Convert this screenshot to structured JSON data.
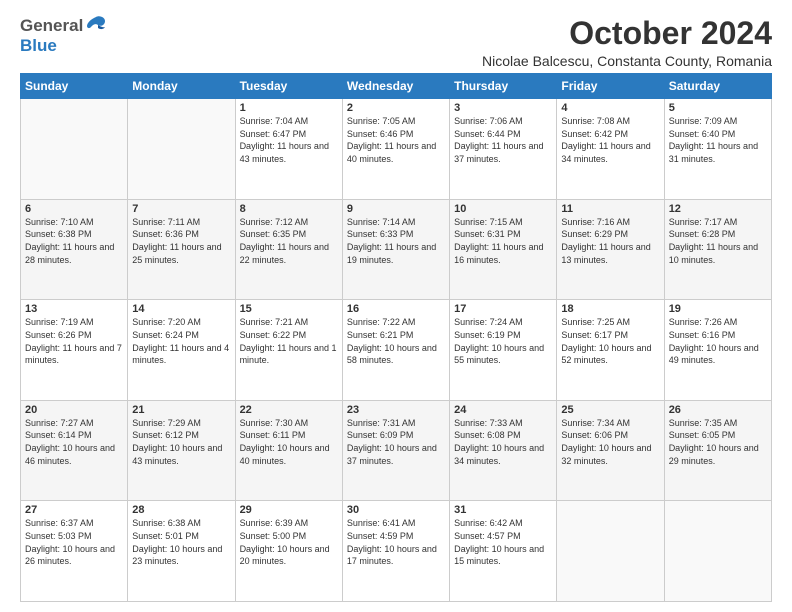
{
  "logo": {
    "general": "General",
    "blue": "Blue"
  },
  "title": "October 2024",
  "location": "Nicolae Balcescu, Constanta County, Romania",
  "weekdays": [
    "Sunday",
    "Monday",
    "Tuesday",
    "Wednesday",
    "Thursday",
    "Friday",
    "Saturday"
  ],
  "weeks": [
    [
      {
        "day": "",
        "info": ""
      },
      {
        "day": "",
        "info": ""
      },
      {
        "day": "1",
        "info": "Sunrise: 7:04 AM\nSunset: 6:47 PM\nDaylight: 11 hours and 43 minutes."
      },
      {
        "day": "2",
        "info": "Sunrise: 7:05 AM\nSunset: 6:46 PM\nDaylight: 11 hours and 40 minutes."
      },
      {
        "day": "3",
        "info": "Sunrise: 7:06 AM\nSunset: 6:44 PM\nDaylight: 11 hours and 37 minutes."
      },
      {
        "day": "4",
        "info": "Sunrise: 7:08 AM\nSunset: 6:42 PM\nDaylight: 11 hours and 34 minutes."
      },
      {
        "day": "5",
        "info": "Sunrise: 7:09 AM\nSunset: 6:40 PM\nDaylight: 11 hours and 31 minutes."
      }
    ],
    [
      {
        "day": "6",
        "info": "Sunrise: 7:10 AM\nSunset: 6:38 PM\nDaylight: 11 hours and 28 minutes."
      },
      {
        "day": "7",
        "info": "Sunrise: 7:11 AM\nSunset: 6:36 PM\nDaylight: 11 hours and 25 minutes."
      },
      {
        "day": "8",
        "info": "Sunrise: 7:12 AM\nSunset: 6:35 PM\nDaylight: 11 hours and 22 minutes."
      },
      {
        "day": "9",
        "info": "Sunrise: 7:14 AM\nSunset: 6:33 PM\nDaylight: 11 hours and 19 minutes."
      },
      {
        "day": "10",
        "info": "Sunrise: 7:15 AM\nSunset: 6:31 PM\nDaylight: 11 hours and 16 minutes."
      },
      {
        "day": "11",
        "info": "Sunrise: 7:16 AM\nSunset: 6:29 PM\nDaylight: 11 hours and 13 minutes."
      },
      {
        "day": "12",
        "info": "Sunrise: 7:17 AM\nSunset: 6:28 PM\nDaylight: 11 hours and 10 minutes."
      }
    ],
    [
      {
        "day": "13",
        "info": "Sunrise: 7:19 AM\nSunset: 6:26 PM\nDaylight: 11 hours and 7 minutes."
      },
      {
        "day": "14",
        "info": "Sunrise: 7:20 AM\nSunset: 6:24 PM\nDaylight: 11 hours and 4 minutes."
      },
      {
        "day": "15",
        "info": "Sunrise: 7:21 AM\nSunset: 6:22 PM\nDaylight: 11 hours and 1 minute."
      },
      {
        "day": "16",
        "info": "Sunrise: 7:22 AM\nSunset: 6:21 PM\nDaylight: 10 hours and 58 minutes."
      },
      {
        "day": "17",
        "info": "Sunrise: 7:24 AM\nSunset: 6:19 PM\nDaylight: 10 hours and 55 minutes."
      },
      {
        "day": "18",
        "info": "Sunrise: 7:25 AM\nSunset: 6:17 PM\nDaylight: 10 hours and 52 minutes."
      },
      {
        "day": "19",
        "info": "Sunrise: 7:26 AM\nSunset: 6:16 PM\nDaylight: 10 hours and 49 minutes."
      }
    ],
    [
      {
        "day": "20",
        "info": "Sunrise: 7:27 AM\nSunset: 6:14 PM\nDaylight: 10 hours and 46 minutes."
      },
      {
        "day": "21",
        "info": "Sunrise: 7:29 AM\nSunset: 6:12 PM\nDaylight: 10 hours and 43 minutes."
      },
      {
        "day": "22",
        "info": "Sunrise: 7:30 AM\nSunset: 6:11 PM\nDaylight: 10 hours and 40 minutes."
      },
      {
        "day": "23",
        "info": "Sunrise: 7:31 AM\nSunset: 6:09 PM\nDaylight: 10 hours and 37 minutes."
      },
      {
        "day": "24",
        "info": "Sunrise: 7:33 AM\nSunset: 6:08 PM\nDaylight: 10 hours and 34 minutes."
      },
      {
        "day": "25",
        "info": "Sunrise: 7:34 AM\nSunset: 6:06 PM\nDaylight: 10 hours and 32 minutes."
      },
      {
        "day": "26",
        "info": "Sunrise: 7:35 AM\nSunset: 6:05 PM\nDaylight: 10 hours and 29 minutes."
      }
    ],
    [
      {
        "day": "27",
        "info": "Sunrise: 6:37 AM\nSunset: 5:03 PM\nDaylight: 10 hours and 26 minutes."
      },
      {
        "day": "28",
        "info": "Sunrise: 6:38 AM\nSunset: 5:01 PM\nDaylight: 10 hours and 23 minutes."
      },
      {
        "day": "29",
        "info": "Sunrise: 6:39 AM\nSunset: 5:00 PM\nDaylight: 10 hours and 20 minutes."
      },
      {
        "day": "30",
        "info": "Sunrise: 6:41 AM\nSunset: 4:59 PM\nDaylight: 10 hours and 17 minutes."
      },
      {
        "day": "31",
        "info": "Sunrise: 6:42 AM\nSunset: 4:57 PM\nDaylight: 10 hours and 15 minutes."
      },
      {
        "day": "",
        "info": ""
      },
      {
        "day": "",
        "info": ""
      }
    ]
  ]
}
